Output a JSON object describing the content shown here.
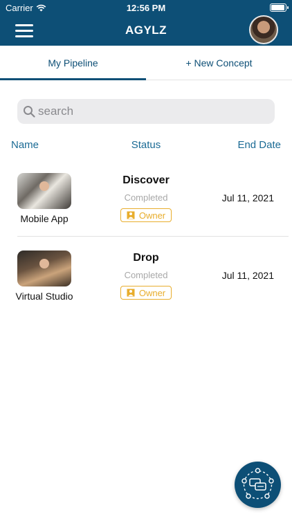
{
  "status_bar": {
    "carrier": "Carrier",
    "time": "12:56 PM",
    "battery_level": 1.0
  },
  "header": {
    "title": "AGYLZ",
    "menu_icon": "hamburger-menu-icon",
    "avatar_icon": "user-avatar"
  },
  "tabs": [
    {
      "label": "My Pipeline",
      "active": true
    },
    {
      "label": "+ New Concept",
      "active": false
    }
  ],
  "search": {
    "placeholder": "search",
    "value": ""
  },
  "columns": {
    "name": "Name",
    "status": "Status",
    "end_date": "End Date"
  },
  "projects": [
    {
      "name": "Mobile App",
      "stage": "Discover",
      "status": "Completed",
      "role": "Owner",
      "end_date": "Jul 11, 2021"
    },
    {
      "name": "Virtual Studio",
      "stage": "Drop",
      "status": "Completed",
      "role": "Owner",
      "end_date": "Jul 11, 2021"
    }
  ],
  "colors": {
    "primary": "#0d4f76",
    "badge": "#e8ad2c",
    "muted": "#a8a8a8"
  },
  "fab": {
    "icon": "team-chat-icon"
  }
}
